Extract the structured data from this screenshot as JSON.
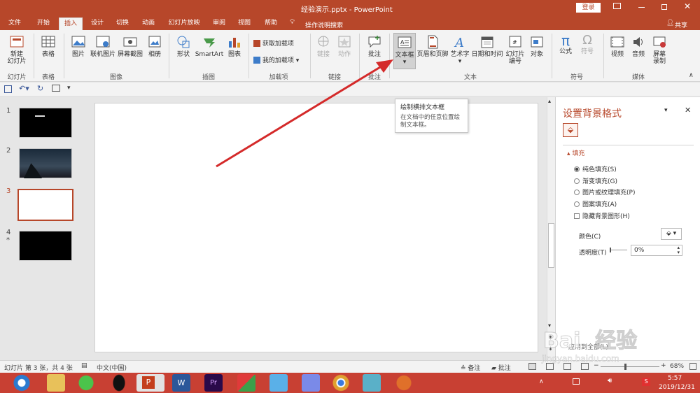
{
  "titlebar": {
    "title": "经验演示.pptx - PowerPoint",
    "login": "登录"
  },
  "tabs": [
    "文件",
    "开始",
    "插入",
    "设计",
    "切换",
    "动画",
    "幻灯片放映",
    "审阅",
    "视图",
    "帮助"
  ],
  "active_tab": "插入",
  "tellme": "操作说明搜索",
  "share": "共享",
  "ribbon": {
    "new_slide": "新建\n幻灯片",
    "table": "表格",
    "picture": "图片",
    "online_picture": "联机图片",
    "screenshot": "屏幕截图",
    "album": "相册",
    "shapes": "形状",
    "smartart": "SmartArt",
    "chart": "图表",
    "get_addins": "获取加载项",
    "my_addins": "我的加载项",
    "link": "链接",
    "action": "动作",
    "comment": "批注",
    "textbox": "文本框",
    "header_footer": "页眉和页脚",
    "wordart": "艺术字",
    "datetime": "日期和时间",
    "slide_number": "幻灯片\n编号",
    "object": "对象",
    "equation": "公式",
    "symbol": "符号",
    "video": "视频",
    "audio": "音频",
    "screen_recording": "屏幕\n录制",
    "groups": {
      "slides": "幻灯片",
      "tables": "表格",
      "images": "图像",
      "illustrations": "插图",
      "addins": "加载项",
      "links": "链接",
      "comments": "批注",
      "text": "文本",
      "symbols": "符号",
      "media": "媒体"
    }
  },
  "tooltip": {
    "title": "绘制横排文本框",
    "body": "在文档中的任意位置绘制文本框。"
  },
  "slides": [
    "1",
    "2",
    "3",
    "4"
  ],
  "slide4_star": "*",
  "format_pane": {
    "title": "设置背景格式",
    "section": "填充",
    "options": [
      "纯色填充(S)",
      "渐变填充(G)",
      "图片或纹理填充(P)",
      "图案填充(A)"
    ],
    "hide_bg": "隐藏背景图形(H)",
    "color_label": "颜色(C)",
    "transparency_label": "透明度(T)",
    "transparency_value": "0%",
    "apply_all": "应用到全部(L)"
  },
  "status": {
    "slide_info": "幻灯片 第 3 张，共 4 张",
    "language": "中文(中国)",
    "notes": "备注",
    "comments": "批注",
    "zoom": "68%"
  },
  "clock": {
    "time": "5:57",
    "date": "2019/12/31"
  },
  "watermark": {
    "brand": "Bai  经验",
    "url": "jingyan.baidu.com"
  },
  "colors": {
    "accent": "#b7472a",
    "taskbar": "#c84033",
    "arrow": "#d42a2a"
  }
}
